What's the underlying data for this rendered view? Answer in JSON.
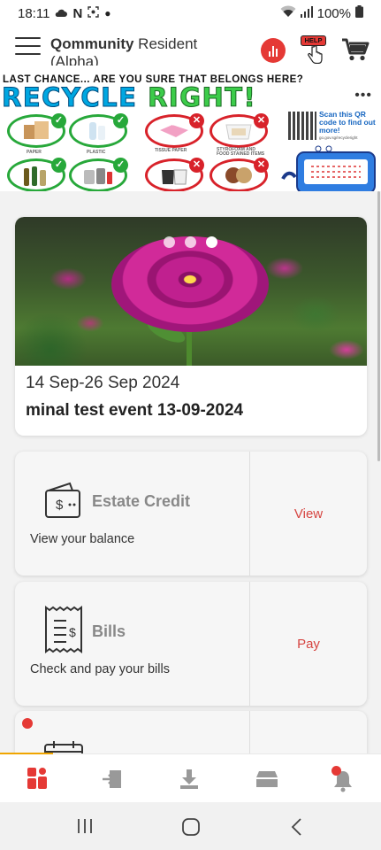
{
  "status_bar": {
    "time": "18:11",
    "battery": "100%",
    "icons": [
      "cloud-icon",
      "n-icon",
      "screenshot-icon",
      "dot-icon",
      "wifi-icon",
      "signal-icon",
      "battery-icon"
    ]
  },
  "header": {
    "title_bold": "Qommunity",
    "title_rest": " Resident (Alpha)",
    "help_label": "HELP",
    "icons": [
      "menu-icon",
      "poll-icon",
      "help-icon",
      "cart-icon"
    ]
  },
  "banner": {
    "line1": "LAST CHANCE... ARE YOU SURE THAT BELONGS HERE?",
    "line2a": "RECYCLE",
    "line2b": "RIGHT!",
    "more": "•••",
    "captions": {
      "paper": "PAPER",
      "plastic": "PLASTIC",
      "tissue": "TISSUE PAPER",
      "styrofoam": "STYROFOAM AND FOOD STAINED ITEMS"
    },
    "qr_text": "Scan this QR code to find out more!",
    "qr_url": "go.gov.sg/recycleright"
  },
  "event": {
    "date": "14 Sep-26 Sep 2024",
    "title": "minal test event 13-09-2024",
    "carousel_total": 3,
    "carousel_active": 3
  },
  "services": [
    {
      "title": "Estate Credit",
      "subtitle": "View your balance",
      "action": "View",
      "icon": "wallet-icon"
    },
    {
      "title": "Bills",
      "subtitle": "Check and pay your bills",
      "action": "Pay",
      "icon": "receipt-icon"
    },
    {
      "title": "",
      "subtitle": "",
      "action": "",
      "icon": "calendar-icon"
    }
  ],
  "bottom_nav": {
    "items": [
      "home-icon",
      "login-icon",
      "download-icon",
      "bookings-icon",
      "notifications-icon"
    ],
    "active": "home-icon"
  },
  "colors": {
    "accent": "#e53935",
    "action_text": "#d64541",
    "recycle_blue": "#00a7e1",
    "recycle_green": "#3ccc4a"
  }
}
